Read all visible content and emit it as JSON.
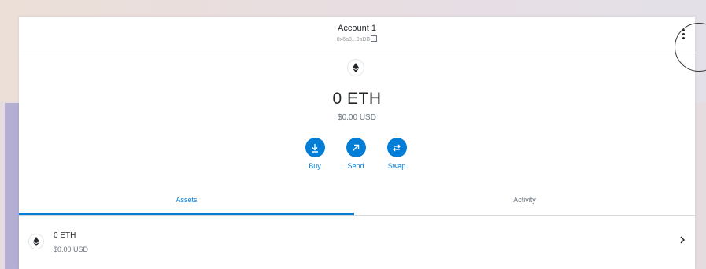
{
  "header": {
    "account_name": "Account 1",
    "account_address": "0x6a8...9aDB",
    "menu_icon": "kebab-menu-icon"
  },
  "balance": {
    "icon": "ethereum-icon",
    "amount": "0 ETH",
    "usd": "$0.00 USD"
  },
  "actions": [
    {
      "label": "Buy",
      "icon": "download-icon"
    },
    {
      "label": "Send",
      "icon": "arrow-up-right-icon"
    },
    {
      "label": "Swap",
      "icon": "swap-icon"
    }
  ],
  "tabs": [
    {
      "label": "Assets",
      "active": true
    },
    {
      "label": "Activity",
      "active": false
    }
  ],
  "assets": [
    {
      "amount": "0 ETH",
      "usd": "$0.00 USD",
      "icon": "ethereum-icon"
    }
  ],
  "colors": {
    "accent": "#037dd6",
    "text_primary": "#24272a",
    "text_muted": "#6a737d"
  }
}
